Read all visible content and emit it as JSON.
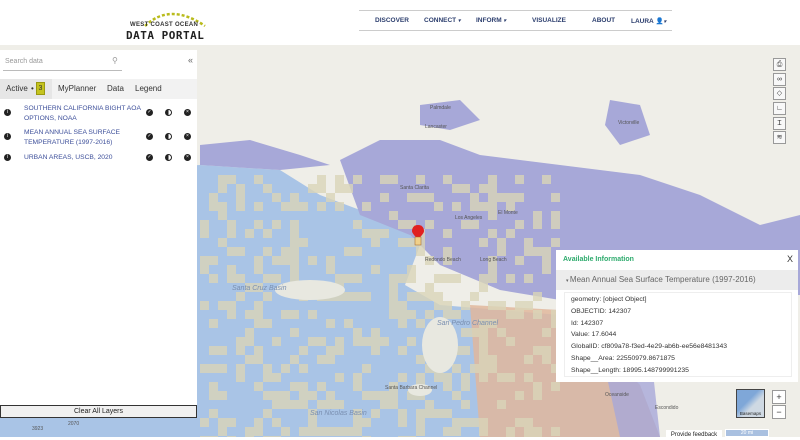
{
  "header": {
    "logo_line1": "WEST COAST OCEAN",
    "logo_line2": "DATA PORTAL",
    "nav": [
      {
        "label": "DISCOVER",
        "dropdown": false
      },
      {
        "label": "CONNECT",
        "dropdown": true
      },
      {
        "label": "INFORM",
        "dropdown": true
      },
      {
        "label": "VISUALIZE",
        "dropdown": false
      },
      {
        "label": "ABOUT",
        "dropdown": false
      },
      {
        "label": "LAURA",
        "dropdown": true,
        "icon": "user-icon"
      }
    ]
  },
  "sidebar": {
    "search_placeholder": "Search data",
    "collapse_icon": "«",
    "tabs": {
      "active": "Active",
      "active_count": "3",
      "myplanner": "MyPlanner",
      "data": "Data",
      "legend": "Legend"
    },
    "layers": [
      {
        "name": "SOUTHERN CALIFORNIA BIGHT AOA OPTIONS, NOAA"
      },
      {
        "name": "MEAN ANNUAL SEA SURFACE TEMPERATURE (1997-2016)"
      },
      {
        "name": "URBAN AREAS, USCB, 2020"
      }
    ],
    "clear_label": "Clear All Layers"
  },
  "map": {
    "labels": [
      "Los Angeles",
      "El Monte",
      "Redondo Beach",
      "Long Beach",
      "Santa Cruz Basin",
      "San Pedro Channel",
      "Santa Barbara Channel",
      "San Nicolas Basin",
      "Oceanside",
      "Escondido",
      "Lancaster",
      "Palmdale",
      "Santa Clarita",
      "Victorville",
      "2070",
      "3923"
    ],
    "tools": [
      "print-icon",
      "link-icon",
      "tag-icon",
      "measure-icon",
      "compare-icon",
      "layers-icon"
    ],
    "basemap_label": "Basemaps",
    "zoom_in": "+",
    "zoom_out": "−",
    "feedback": "Provide feedback",
    "scale": "20 mi",
    "colors": {
      "ocean": "#a9c4e6",
      "urban": "#a7a8d8",
      "warm": "#e0b79c",
      "tile": "#d9d5b8"
    }
  },
  "popup": {
    "title": "Available Information",
    "close": "X",
    "section": "Mean Annual Sea Surface Temperature (1997-2016)",
    "properties": [
      "geometry: [object Object]",
      "OBJECTID: 142307",
      "Id: 142307",
      "Value: 17.6044",
      "GlobalID: cf809a78-f3ed-4e29-ab6b-ee56e8481343",
      "Shape__Area: 22550979.8671875",
      "Shape__Length: 18995.148799991235"
    ]
  }
}
